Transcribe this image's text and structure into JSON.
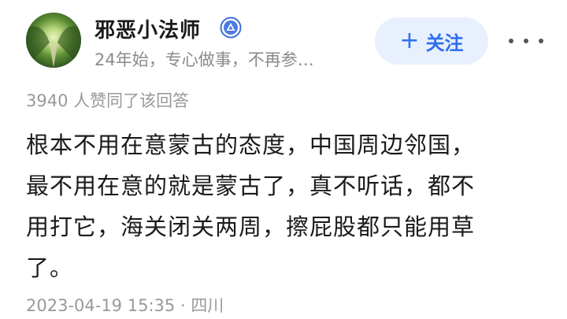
{
  "author": {
    "name": "邪恶小法师",
    "bio": "24年始，专心做事，不再参…",
    "badge_icon": "verified-badge-icon",
    "avatar_icon": "green-tunnel-avatar"
  },
  "actions": {
    "follow_plus": "+",
    "follow_label": "关注",
    "more_icon": "more-dots-icon"
  },
  "likes_text": "3940 人赞同了该回答",
  "answer": {
    "lines": [
      "根本不用在意蒙古的态度，中国周边邻国，",
      "最不用在意的就是蒙古了，真不听话，都不",
      "用打它，海关闭关两周，擦屁股都只能用草",
      "了。"
    ]
  },
  "meta": {
    "datetime": "2023-04-19 15:35",
    "separator": "·",
    "location": "四川"
  },
  "colors": {
    "accent": "#2c6ef2",
    "follow_bg": "#e9f0fd",
    "muted_text": "#999999"
  }
}
